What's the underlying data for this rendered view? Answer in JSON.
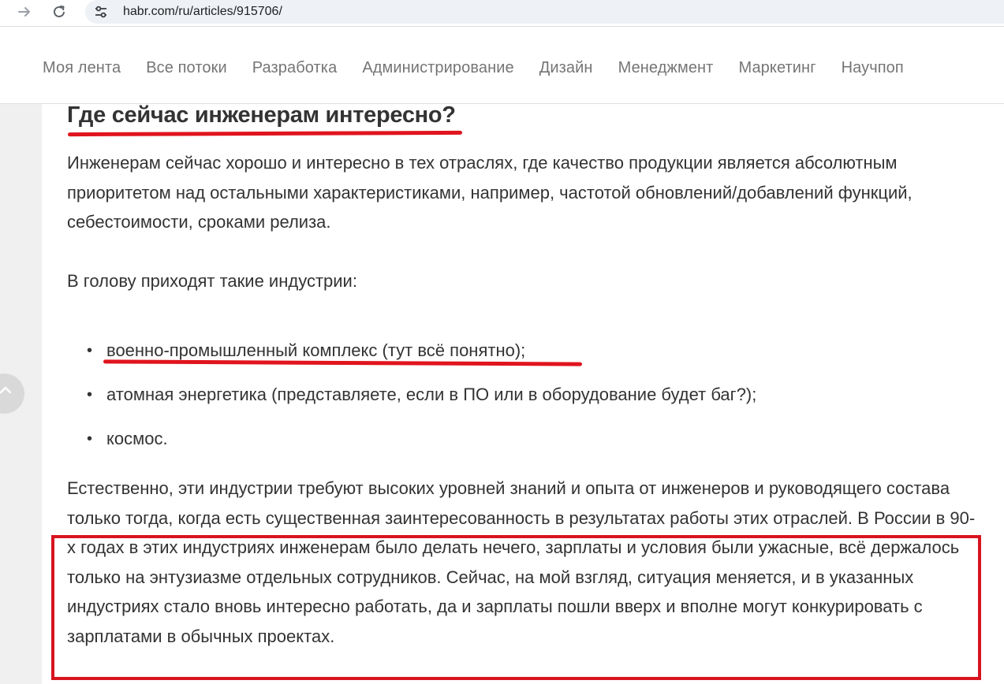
{
  "browser": {
    "url": "habr.com/ru/articles/915706/"
  },
  "header": {
    "flows": [
      {
        "label": "Моя лента"
      },
      {
        "label": "Все потоки"
      },
      {
        "label": "Разработка"
      },
      {
        "label": "Администрирование"
      },
      {
        "label": "Дизайн"
      },
      {
        "label": "Менеджмент"
      },
      {
        "label": "Маркетинг"
      },
      {
        "label": "Научпоп"
      }
    ]
  },
  "article": {
    "heading": "Где сейчас инженерам интересно?",
    "paragraph1": "Инженерам сейчас хорошо и интересно в тех отраслях, где качество продукции является абсолютным приоритетом над остальными характеристиками, например, частотой обновлений/добавлений функций, себестоимости, сроками релиза.",
    "paragraph2": "В голову приходят такие индустрии:",
    "list": [
      {
        "text": "военно-промышленный комплекс (тут всё понятно);"
      },
      {
        "text": "атомная энергетика (представляете, если в ПО или в оборудование будет баг?);"
      },
      {
        "text": "космос."
      }
    ],
    "paragraph3": "Естественно, эти индустрии требуют высоких уровней знаний и опыта от инженеров и руководящего состава только тогда, когда есть существенная заинтересованность в результатах работы этих отраслей. В России в 90-х годах в этих индустриях инженерам было делать нечего, зарплаты и условия были ужасные, всё держалось только на энтузиазме отдельных сотрудников. Сейчас, на мой взгляд, ситуация меняется, и в указанных индустриях стало вновь интересно работать, да и зарплаты пошли вверх и вполне могут конкурировать с зарплатами в обычных проектах."
  },
  "colors": {
    "annotation_red": "#e0141e",
    "text": "#333333",
    "nav_text": "#757575"
  },
  "icons": {
    "back": "arrow-right-icon",
    "reload": "reload-icon",
    "site_info": "tune-icon",
    "scroll_up": "chevron-up-icon"
  }
}
